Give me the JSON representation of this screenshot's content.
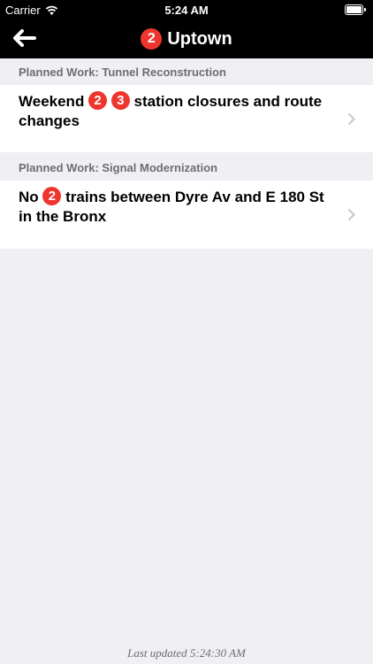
{
  "status_bar": {
    "carrier": "Carrier",
    "time": "5:24 AM",
    "wifi_icon": "wifi-icon",
    "battery_icon": "battery-icon"
  },
  "nav": {
    "back_icon": "back-arrow-icon",
    "route_bullet": "2",
    "title": "Uptown",
    "bullet_color": "#ee352e"
  },
  "sections": [
    {
      "header": "Planned Work: Tunnel Reconstruction",
      "item": {
        "prefix": "Weekend",
        "bullets": [
          "2",
          "3"
        ],
        "text": "station closures and route changes"
      }
    },
    {
      "header": "Planned Work: Signal Modernization",
      "item": {
        "prefix": "No",
        "bullets": [
          "2"
        ],
        "text": "trains between Dyre Av and E 180 St in the Bronx"
      }
    }
  ],
  "footer": {
    "last_updated": "Last updated 5:24:30 AM"
  },
  "colors": {
    "background": "#efeff4",
    "bar": "#000000",
    "section_text": "#6d6d72",
    "chevron": "#c7c7cc"
  }
}
